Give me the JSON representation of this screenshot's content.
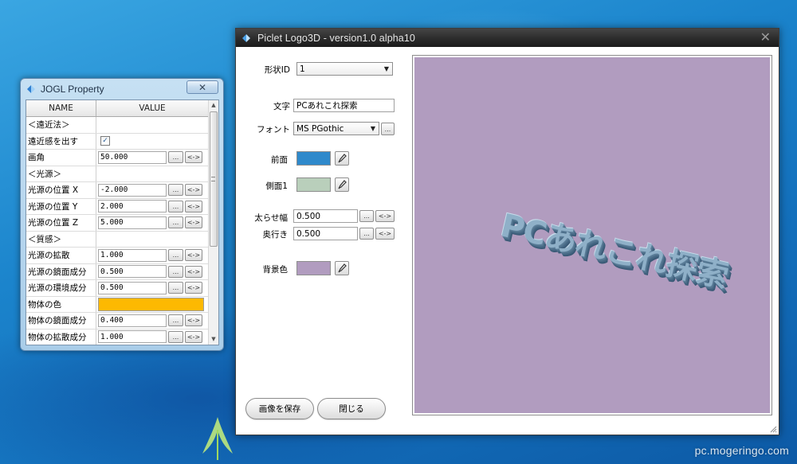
{
  "desktop": {
    "watermark": "pc.mogeringo.com"
  },
  "jogl": {
    "title": "JOGL Property",
    "close_glyph": "✕",
    "headers": {
      "name": "NAME",
      "value": "VALUE"
    },
    "rows": [
      {
        "name": "＜遠近法＞",
        "type": "section"
      },
      {
        "name": "遠近感を出す",
        "type": "check",
        "checked": true
      },
      {
        "name": "画角",
        "type": "num",
        "value": "50.000"
      },
      {
        "name": "＜光源＞",
        "type": "section"
      },
      {
        "name": "光源の位置 X",
        "type": "num",
        "value": "-2.000"
      },
      {
        "name": "光源の位置 Y",
        "type": "num",
        "value": "2.000"
      },
      {
        "name": "光源の位置 Z",
        "type": "num",
        "value": "5.000"
      },
      {
        "name": "＜質感＞",
        "type": "section"
      },
      {
        "name": "光源の拡散",
        "type": "num",
        "value": "1.000"
      },
      {
        "name": "光源の鏡面成分",
        "type": "num",
        "value": "0.500"
      },
      {
        "name": "光源の環境成分",
        "type": "num",
        "value": "0.500"
      },
      {
        "name": "物体の色",
        "type": "color",
        "color": "#fdb901"
      },
      {
        "name": "物体の鏡面成分",
        "type": "num",
        "value": "0.400"
      },
      {
        "name": "物体の拡散成分",
        "type": "num",
        "value": "1.000"
      }
    ],
    "dots_label": "...",
    "arrow_label": "<->"
  },
  "main": {
    "title": "Piclet Logo3D - version1.0 alpha10",
    "close_glyph": "✕",
    "shape_label": "形状ID",
    "shape_value": "1",
    "text_label": "文字",
    "text_value": "PCあれこれ探索",
    "font_label": "フォント",
    "font_value": "MS PGothic",
    "front_label": "前面",
    "front_color": "#2f89cb",
    "side_label": "側面1",
    "side_color": "#b9cfbb",
    "thickness_label": "太らせ幅",
    "thickness_value": "0.500",
    "depth_label": "奥行き",
    "depth_value": "0.500",
    "bg_label": "背景色",
    "bg_color": "#b19cbf",
    "dots_label": "...",
    "arrow_label": "<->",
    "preview_text": "PCあれこれ探索",
    "save_button": "画像を保存",
    "close_button": "閉じる"
  }
}
